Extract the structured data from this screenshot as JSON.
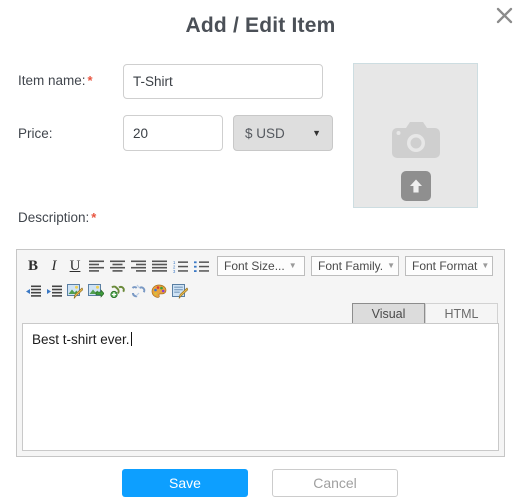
{
  "dialog": {
    "title": "Add / Edit Item",
    "close_icon": "close-icon"
  },
  "form": {
    "item_name": {
      "label": "Item name:",
      "required_marker": "*",
      "value": "T-Shirt",
      "placeholder": ""
    },
    "price": {
      "label": "Price:",
      "value": "20",
      "placeholder": ""
    },
    "currency": {
      "selected": "$ USD",
      "caret": "▼"
    },
    "description": {
      "label": "Description:",
      "required_marker": "*"
    }
  },
  "image_uploader": {
    "camera_icon": "camera-icon",
    "upload_icon": "upload-arrow-icon"
  },
  "editor": {
    "toolbar_row1": [
      {
        "name": "bold-button",
        "label": "B",
        "style": "bold"
      },
      {
        "name": "italic-button",
        "label": "I",
        "style": "italic"
      },
      {
        "name": "underline-button",
        "label": "U",
        "style": "underline"
      },
      {
        "name": "align-left-button",
        "label": "align-left-icon",
        "style": "icon"
      },
      {
        "name": "align-center-button",
        "label": "align-center-icon",
        "style": "icon"
      },
      {
        "name": "align-right-button",
        "label": "align-right-icon",
        "style": "icon"
      },
      {
        "name": "justify-button",
        "label": "align-justify-icon",
        "style": "icon"
      },
      {
        "name": "ordered-list-button",
        "label": "ordered-list-icon",
        "style": "icon"
      },
      {
        "name": "unordered-list-button",
        "label": "unordered-list-icon",
        "style": "icon"
      }
    ],
    "toolbar_row2": [
      {
        "name": "outdent-button",
        "label": "outdent-icon"
      },
      {
        "name": "indent-button",
        "label": "indent-icon"
      },
      {
        "name": "edit-image-button",
        "label": "image-edit-icon"
      },
      {
        "name": "insert-image-button",
        "label": "image-insert-icon"
      },
      {
        "name": "insert-link-button",
        "label": "link-add-icon"
      },
      {
        "name": "remove-link-button",
        "label": "link-break-icon"
      },
      {
        "name": "text-color-button",
        "label": "color-palette-icon"
      },
      {
        "name": "source-edit-button",
        "label": "source-edit-icon"
      }
    ],
    "font_size": {
      "label": "Font Size...",
      "caret": "▼"
    },
    "font_family": {
      "label": "Font Family.",
      "caret": "▼"
    },
    "font_format": {
      "label": "Font Format",
      "caret": "▼"
    },
    "tabs": [
      {
        "label": "Visual",
        "active": true
      },
      {
        "label": "HTML",
        "active": false
      }
    ],
    "content": "Best t-shirt ever."
  },
  "footer": {
    "save_label": "Save",
    "cancel_label": "Cancel"
  },
  "colors": {
    "accent_blue": "#0d9fff",
    "required_red": "#e8543f",
    "title_gray": "#4b5057",
    "panel_gray": "#f5f5f5",
    "image_placeholder": "#e7e7e7"
  }
}
